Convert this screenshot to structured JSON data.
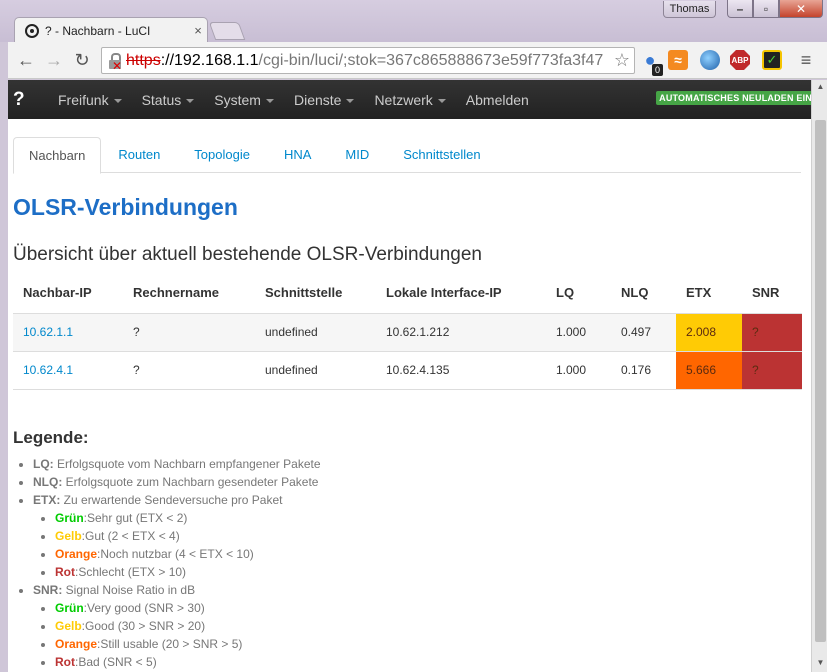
{
  "browser": {
    "tab_title": "? - Nachbarn - LuCI",
    "tab_close": "×",
    "user": "Thomas",
    "window_buttons": {
      "minimize": "–",
      "maximize": "▫",
      "close": "✕"
    },
    "url": {
      "scheme": "https",
      "host": "://192.168.1.1",
      "path": "/cgi-bin/luci/;stok=367c865888673e59f773fa3f47"
    },
    "extensions": {
      "ghost_badge": "0",
      "abp_label": "ABP"
    }
  },
  "navbar": {
    "brand": "?",
    "items": [
      {
        "label": "Freifunk",
        "has_caret": true
      },
      {
        "label": "Status",
        "has_caret": true
      },
      {
        "label": "System",
        "has_caret": true
      },
      {
        "label": "Dienste",
        "has_caret": true
      },
      {
        "label": "Netzwerk",
        "has_caret": true
      },
      {
        "label": "Abmelden",
        "has_caret": false
      }
    ],
    "autorefresh": "AUTOMATISCHES NEULADEN EIN"
  },
  "tabs": [
    {
      "label": "Nachbarn",
      "active": true
    },
    {
      "label": "Routen",
      "active": false
    },
    {
      "label": "Topologie",
      "active": false
    },
    {
      "label": "HNA",
      "active": false
    },
    {
      "label": "MID",
      "active": false
    },
    {
      "label": "Schnittstellen",
      "active": false
    }
  ],
  "page": {
    "title": "OLSR-Verbindungen",
    "subtitle": "Übersicht über aktuell bestehende OLSR-Verbindungen"
  },
  "table": {
    "columns": [
      "Nachbar-IP",
      "Rechnername",
      "Schnittstelle",
      "Lokale Interface-IP",
      "LQ",
      "NLQ",
      "ETX",
      "SNR"
    ],
    "rows": [
      {
        "neighbor_ip": "10.62.1.1",
        "hostname": "?",
        "interface": "undefined",
        "local_ip": "10.62.1.212",
        "lq": "1.000",
        "nlq": "0.497",
        "etx": "2.008",
        "snr": "?",
        "etx_color": "#ffcb05",
        "snr_color": "#bb3333"
      },
      {
        "neighbor_ip": "10.62.4.1",
        "hostname": "?",
        "interface": "undefined",
        "local_ip": "10.62.4.135",
        "lq": "1.000",
        "nlq": "0.176",
        "etx": "5.666",
        "snr": "?",
        "etx_color": "#ff6600",
        "snr_color": "#bb3333"
      }
    ]
  },
  "legend": {
    "title": "Legende:",
    "lq": {
      "key": "LQ:",
      "text": " Erfolgsquote vom Nachbarn empfangener Pakete"
    },
    "nlq": {
      "key": "NLQ:",
      "text": " Erfolgsquote zum Nachbarn gesendeter Pakete"
    },
    "etx": {
      "key": "ETX:",
      "text": " Zu erwartende Sendeversuche pro Paket",
      "items": [
        {
          "key": "Grün",
          "text": ":Sehr gut (ETX < 2)",
          "color": "#00cc00"
        },
        {
          "key": "Gelb",
          "text": ":Gut (2 < ETX < 4)",
          "color": "#ffcb05"
        },
        {
          "key": "Orange",
          "text": ":Noch nutzbar (4 < ETX < 10)",
          "color": "#ff6600"
        },
        {
          "key": "Rot",
          "text": ":Schlecht (ETX > 10)",
          "color": "#bb3333"
        }
      ]
    },
    "snr": {
      "key": "SNR:",
      "text": " Signal Noise Ratio in dB",
      "items": [
        {
          "key": "Grün",
          "text": ":Very good (SNR > 30)",
          "color": "#00cc00"
        },
        {
          "key": "Gelb",
          "text": ":Good (30 > SNR > 20)",
          "color": "#ffcb05"
        },
        {
          "key": "Orange",
          "text": ":Still usable (20 > SNR > 5)",
          "color": "#ff6600"
        },
        {
          "key": "Rot",
          "text": ":Bad (SNR < 5)",
          "color": "#bb3333"
        }
      ]
    }
  }
}
